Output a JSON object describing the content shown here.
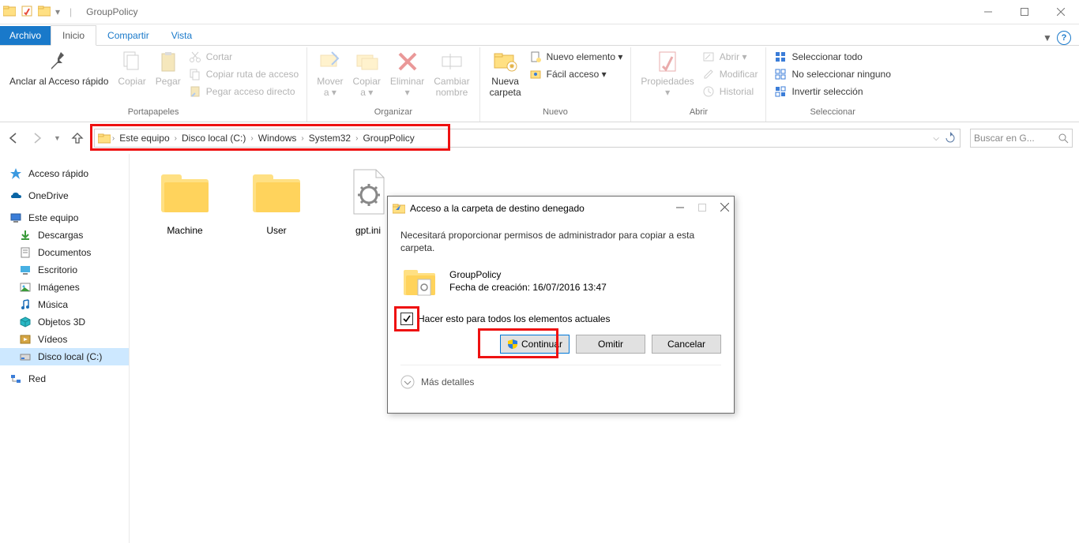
{
  "title": "GroupPolicy",
  "tabs": {
    "file": "Archivo",
    "home": "Inicio",
    "share": "Compartir",
    "view": "Vista"
  },
  "ribbon": {
    "portapapeles": "Portapapeles",
    "organizar": "Organizar",
    "nuevo": "Nuevo",
    "abrir": "Abrir",
    "seleccionar": "Seleccionar",
    "pin": "Anclar al Acceso rápido",
    "copiar": "Copiar",
    "pegar": "Pegar",
    "cortar": "Cortar",
    "copiarruta": "Copiar ruta de acceso",
    "pegaracceso": "Pegar acceso directo",
    "movera": "Mover a",
    "copiara": "Copiar a",
    "eliminar": "Eliminar",
    "cambiarnombre": "Cambiar nombre",
    "nuevacarpeta": "Nueva carpeta",
    "nuevoelemento": "Nuevo elemento",
    "facilacceso": "Fácil acceso",
    "propiedades": "Propiedades",
    "abrir2": "Abrir",
    "modificar": "Modificar",
    "historial": "Historial",
    "selecttodo": "Seleccionar todo",
    "selectnone": "No seleccionar ninguno",
    "invert": "Invertir selección"
  },
  "breadcrumb": [
    "Este equipo",
    "Disco local (C:)",
    "Windows",
    "System32",
    "GroupPolicy"
  ],
  "search_placeholder": "Buscar en G...",
  "sidebar": {
    "quick": "Acceso rápido",
    "onedrive": "OneDrive",
    "thispc": "Este equipo",
    "downloads": "Descargas",
    "documents": "Documentos",
    "desktop": "Escritorio",
    "images": "Imágenes",
    "music": "Música",
    "objects3d": "Objetos 3D",
    "videos": "Vídeos",
    "diskc": "Disco local (C:)",
    "network": "Red"
  },
  "files": {
    "machine": "Machine",
    "user": "User",
    "gpt": "gpt.ini"
  },
  "dialog": {
    "title": "Acceso a la carpeta de destino denegado",
    "msg": "Necesitará proporcionar permisos de administrador para copiar a esta carpeta.",
    "foldername": "GroupPolicy",
    "folderdate": "Fecha de creación: 16/07/2016 13:47",
    "check": "Hacer esto para todos los elementos actuales",
    "continue": "Continuar",
    "skip": "Omitir",
    "cancel": "Cancelar",
    "more": "Más detalles"
  }
}
